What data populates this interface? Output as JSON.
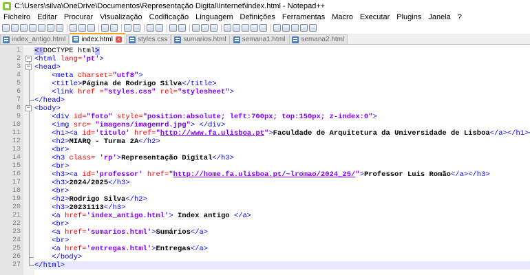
{
  "window": {
    "title": "C:\\Users\\silva\\OneDrive\\Documentos\\Representação Digital\\Internet\\index.html - Notepad++"
  },
  "menu": [
    "Ficheiro",
    "Editar",
    "Procurar",
    "Visualização",
    "Codificação",
    "Linguagem",
    "Definições",
    "Ferramentas",
    "Macro",
    "Executar",
    "Plugins",
    "Janela",
    "?"
  ],
  "tabs": [
    {
      "label": "index_antigo.html",
      "active": false
    },
    {
      "label": "index.html",
      "active": true
    },
    {
      "label": "styles.css",
      "active": false
    },
    {
      "label": "sumarios.html",
      "active": false
    },
    {
      "label": "semana1.html",
      "active": false
    },
    {
      "label": "semana2.html",
      "active": false
    }
  ],
  "colors": {
    "tag": "#0000ff",
    "attr": "#ff0000",
    "value": "#8000ff",
    "current_line": "#e8e8ff"
  },
  "current_line": 27,
  "code": [
    [
      [
        "d",
        "<!"
      ],
      [
        "d",
        "DOCTYPE html"
      ],
      [
        "d",
        ">"
      ]
    ],
    [
      [
        "t",
        "<html "
      ],
      [
        "a",
        "lang="
      ],
      [
        "v",
        "'pt'"
      ],
      [
        "t",
        ">"
      ]
    ],
    [
      [
        "t",
        "<head>"
      ]
    ],
    [
      [
        "s",
        "    "
      ],
      [
        "t",
        "<meta "
      ],
      [
        "a",
        "charset="
      ],
      [
        "v",
        "\"utf8\""
      ],
      [
        "t",
        ">"
      ]
    ],
    [
      [
        "s",
        "    "
      ],
      [
        "t",
        "<title>"
      ],
      [
        "x",
        "Página de Rodrigo Silva"
      ],
      [
        "t",
        "</title>"
      ]
    ],
    [
      [
        "s",
        "    "
      ],
      [
        "t",
        "<link "
      ],
      [
        "a",
        "href ="
      ],
      [
        "v",
        "\"styles.css\""
      ],
      [
        "a",
        " rel="
      ],
      [
        "v",
        "\"stylesheet\""
      ],
      [
        "t",
        ">"
      ]
    ],
    [
      [
        "t",
        "</head>"
      ]
    ],
    [
      [
        "t",
        "<body>"
      ]
    ],
    [
      [
        "s",
        "    "
      ],
      [
        "t",
        "<div "
      ],
      [
        "a",
        "id="
      ],
      [
        "v",
        "\"foto\""
      ],
      [
        "a",
        " style="
      ],
      [
        "v",
        "\"position:absolute; left:700px; top:150px; z-index:0\""
      ],
      [
        "t",
        ">"
      ]
    ],
    [
      [
        "s",
        "    "
      ],
      [
        "t",
        "<img "
      ],
      [
        "a",
        "src= "
      ],
      [
        "v",
        "\"imagens/imagemrd.jpg\""
      ],
      [
        "t",
        "> </div>"
      ]
    ],
    [
      [
        "s",
        "    "
      ],
      [
        "t",
        "<h1><a "
      ],
      [
        "a",
        "id="
      ],
      [
        "v",
        "'titulo'"
      ],
      [
        "a",
        " href="
      ],
      [
        "v",
        "\""
      ],
      [
        "l",
        "http://www.fa.ulisboa.pt"
      ],
      [
        "v",
        "\""
      ],
      [
        "t",
        ">"
      ],
      [
        "x",
        "Faculdade de Arquitetura da Universidade de Lisboa"
      ],
      [
        "t",
        "</a></h1><br>"
      ]
    ],
    [
      [
        "s",
        "    "
      ],
      [
        "t",
        "<h2>"
      ],
      [
        "x",
        "MIARQ - Turma 2A"
      ],
      [
        "t",
        "</h2>"
      ]
    ],
    [
      [
        "s",
        "    "
      ],
      [
        "t",
        "<br>"
      ]
    ],
    [
      [
        "s",
        "    "
      ],
      [
        "t",
        "<h3 "
      ],
      [
        "a",
        "class= "
      ],
      [
        "v",
        "'rp'"
      ],
      [
        "t",
        ">"
      ],
      [
        "x",
        "Representação Digital"
      ],
      [
        "t",
        "</h3>"
      ]
    ],
    [
      [
        "s",
        "    "
      ],
      [
        "t",
        "<br>"
      ]
    ],
    [
      [
        "s",
        "    "
      ],
      [
        "t",
        "<h3><a "
      ],
      [
        "a",
        "id="
      ],
      [
        "v",
        "'professor'"
      ],
      [
        "a",
        " href="
      ],
      [
        "v",
        "\""
      ],
      [
        "l",
        "http://home.fa.ulisboa.pt/~lromao/2024_25/"
      ],
      [
        "v",
        "\""
      ],
      [
        "t",
        ">"
      ],
      [
        "x",
        "Professor Luis Romão"
      ],
      [
        "t",
        "</a></h3>"
      ]
    ],
    [
      [
        "s",
        "    "
      ],
      [
        "t",
        "<h3>"
      ],
      [
        "x",
        "2024/2025"
      ],
      [
        "t",
        "</h3>"
      ]
    ],
    [
      [
        "s",
        "    "
      ],
      [
        "t",
        "<br>"
      ]
    ],
    [
      [
        "s",
        "    "
      ],
      [
        "t",
        "<h2>"
      ],
      [
        "x",
        "Rodrigo Silva"
      ],
      [
        "t",
        "</h2>"
      ]
    ],
    [
      [
        "s",
        "    "
      ],
      [
        "t",
        "<h3>"
      ],
      [
        "x",
        "20231113"
      ],
      [
        "t",
        "</h3>"
      ]
    ],
    [
      [
        "s",
        "    "
      ],
      [
        "t",
        "<a "
      ],
      [
        "a",
        "href="
      ],
      [
        "v",
        "'index_antigo.html'"
      ],
      [
        "t",
        ">"
      ],
      [
        "x",
        " Index antigo "
      ],
      [
        "t",
        "</a>"
      ]
    ],
    [
      [
        "s",
        "    "
      ],
      [
        "t",
        "<br>"
      ]
    ],
    [
      [
        "s",
        "    "
      ],
      [
        "t",
        "<a "
      ],
      [
        "a",
        "href="
      ],
      [
        "v",
        "'sumarios.html'"
      ],
      [
        "t",
        ">"
      ],
      [
        "x",
        "Sumários"
      ],
      [
        "t",
        "</a>"
      ]
    ],
    [
      [
        "s",
        "    "
      ],
      [
        "t",
        "<br>"
      ]
    ],
    [
      [
        "s",
        "    "
      ],
      [
        "t",
        "<a "
      ],
      [
        "a",
        "href="
      ],
      [
        "v",
        "'entregas.html'"
      ],
      [
        "t",
        ">"
      ],
      [
        "x",
        "Entregas"
      ],
      [
        "t",
        "</a>"
      ]
    ],
    [
      [
        "s",
        "    "
      ],
      [
        "t",
        "</body>"
      ]
    ],
    [
      [
        "t",
        "</html>"
      ]
    ]
  ]
}
